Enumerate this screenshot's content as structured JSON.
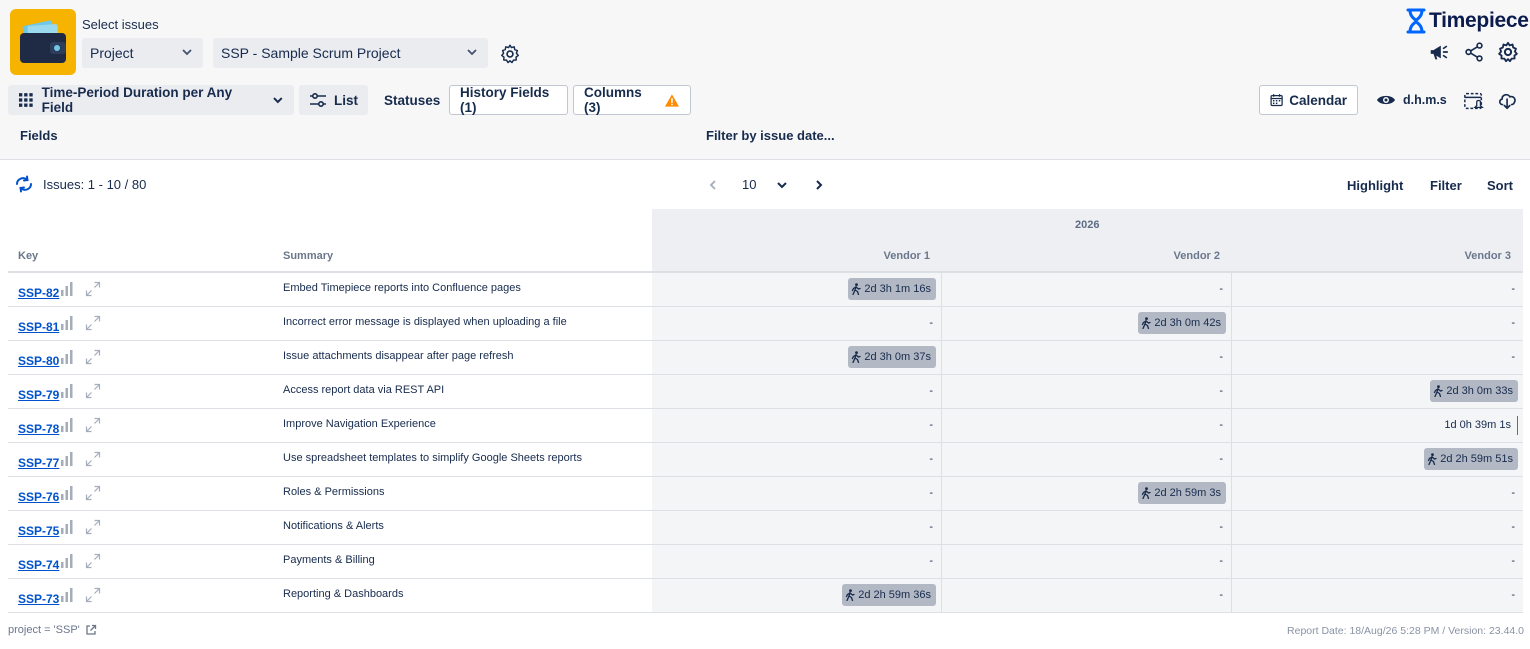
{
  "header": {
    "select_issues_label": "Select issues",
    "scope_dropdown": "Project",
    "project_dropdown": "SSP - Sample Scrum Project",
    "brand_name": "Timepiece",
    "colors": {
      "logo_bg": "#f6b300",
      "brand": "#0052cc",
      "chip": "#b3b9c4",
      "link": "#0052cc",
      "warning": "#ff8b00"
    }
  },
  "toolbar": {
    "report_type": "Time-Period Duration per Any Field",
    "list_label": "List",
    "statuses_label": "Statuses",
    "history_fields_label": "History Fields (1)",
    "columns_label": "Columns (3)",
    "calendar_label": "Calendar",
    "format_label": "d.h.m.s",
    "fields_label": "Fields",
    "filter_date_label": "Filter by issue date..."
  },
  "results": {
    "issues_count": "Issues: 1 - 10 / 80",
    "page_size": "10",
    "highlight_label": "Highlight",
    "filter_label": "Filter",
    "sort_label": "Sort"
  },
  "table": {
    "year": "2026",
    "key_header": "Key",
    "summary_header": "Summary",
    "columns": [
      "Vendor 1",
      "Vendor 2",
      "Vendor 3"
    ],
    "rows": [
      {
        "key": "SSP-82",
        "summary": "Embed Timepiece reports into Confluence pages",
        "cells": [
          {
            "t": "chip",
            "v": "2d 3h 1m 16s"
          },
          {
            "t": "dash",
            "v": "-"
          },
          {
            "t": "dash",
            "v": "-"
          }
        ]
      },
      {
        "key": "SSP-81",
        "summary": "Incorrect error message is displayed when uploading a file",
        "cells": [
          {
            "t": "dash",
            "v": "-"
          },
          {
            "t": "chip",
            "v": "2d 3h 0m 42s"
          },
          {
            "t": "dash",
            "v": "-"
          }
        ]
      },
      {
        "key": "SSP-80",
        "summary": "Issue attachments disappear after page refresh",
        "cells": [
          {
            "t": "chip",
            "v": "2d 3h 0m 37s"
          },
          {
            "t": "dash",
            "v": "-"
          },
          {
            "t": "dash",
            "v": "-"
          }
        ]
      },
      {
        "key": "SSP-79",
        "summary": "Access report data via REST API",
        "cells": [
          {
            "t": "dash",
            "v": "-"
          },
          {
            "t": "dash",
            "v": "-"
          },
          {
            "t": "chip",
            "v": "2d 3h 0m 33s"
          }
        ]
      },
      {
        "key": "SSP-78",
        "summary": "Improve Navigation Experience",
        "cells": [
          {
            "t": "dash",
            "v": "-"
          },
          {
            "t": "dash",
            "v": "-"
          },
          {
            "t": "plain",
            "v": "1d 0h 39m 1s"
          }
        ]
      },
      {
        "key": "SSP-77",
        "summary": "Use spreadsheet templates to simplify Google Sheets reports",
        "cells": [
          {
            "t": "dash",
            "v": "-"
          },
          {
            "t": "dash",
            "v": "-"
          },
          {
            "t": "chip",
            "v": "2d 2h 59m 51s"
          }
        ]
      },
      {
        "key": "SSP-76",
        "summary": "Roles & Permissions",
        "cells": [
          {
            "t": "dash",
            "v": "-"
          },
          {
            "t": "chip",
            "v": "2d 2h 59m 3s"
          },
          {
            "t": "dash",
            "v": "-"
          }
        ]
      },
      {
        "key": "SSP-75",
        "summary": "Notifications & Alerts",
        "cells": [
          {
            "t": "dash",
            "v": "-"
          },
          {
            "t": "dash",
            "v": "-"
          },
          {
            "t": "dash",
            "v": "-"
          }
        ]
      },
      {
        "key": "SSP-74",
        "summary": "Payments & Billing",
        "cells": [
          {
            "t": "dash",
            "v": "-"
          },
          {
            "t": "dash",
            "v": "-"
          },
          {
            "t": "dash",
            "v": "-"
          }
        ]
      },
      {
        "key": "SSP-73",
        "summary": "Reporting & Dashboards",
        "cells": [
          {
            "t": "chip",
            "v": "2d 2h 59m 36s"
          },
          {
            "t": "dash",
            "v": "-"
          },
          {
            "t": "dash",
            "v": "-"
          }
        ]
      }
    ]
  },
  "footer": {
    "jql": "project = 'SSP'",
    "report_info": "Report Date: 18/Aug/26 5:28 PM / Version: 23.44.0"
  }
}
